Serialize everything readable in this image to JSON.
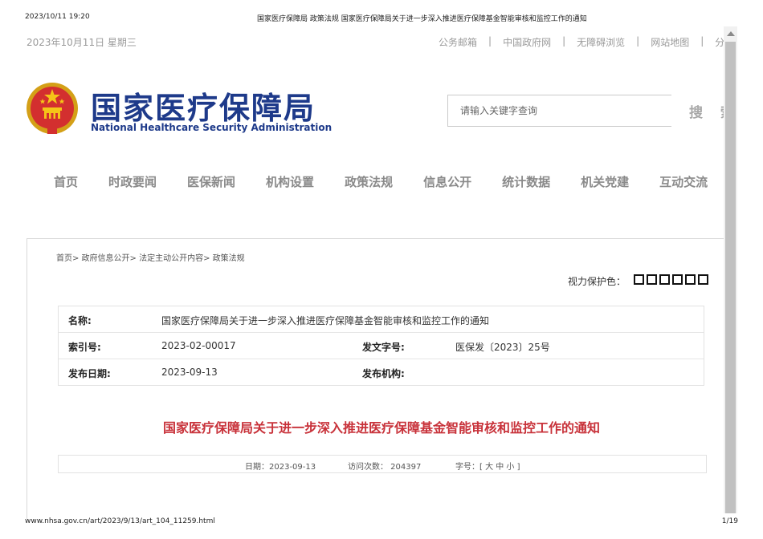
{
  "print": {
    "datetime": "2023/10/11 19:20",
    "title": "国家医疗保障局 政策法规 国家医疗保障局关于进一步深入推进医疗保障基金智能审核和监控工作的通知",
    "url": "www.nhsa.gov.cn/art/2023/9/13/art_104_11259.html",
    "page": "1/19"
  },
  "topbar": {
    "date": "2023年10月11日 星期三",
    "links": [
      "公务邮箱",
      "中国政府网",
      "无障碍浏览",
      "网站地图",
      "分"
    ]
  },
  "logo": {
    "cn": "国家医疗保障局",
    "en": "National Healthcare Security Administration"
  },
  "search": {
    "placeholder": "请输入关键字查询",
    "button": "搜 索"
  },
  "nav": [
    "首页",
    "时政要闻",
    "医保新闻",
    "机构设置",
    "政策法规",
    "信息公开",
    "统计数据",
    "机关党建",
    "互动交流"
  ],
  "breadcrumb": "首页> 政府信息公开> 法定主动公开内容> 政策法规",
  "eye_protect": {
    "label": "视力保护色：",
    "colors": [
      "#ffffff",
      "#ffffff",
      "#ffffff",
      "#ffffff",
      "#ffffff",
      "#ffffff"
    ]
  },
  "info": {
    "name_label": "名称:",
    "name": "国家医疗保障局关于进一步深入推进医疗保障基金智能审核和监控工作的通知",
    "index_label": "索引号:",
    "index": "2023-02-00017",
    "doc_no_label": "发文字号:",
    "doc_no": "医保发〔2023〕25号",
    "date_label": "发布日期:",
    "date": "2023-09-13",
    "org_label": "发布机构:",
    "org": ""
  },
  "doc_title": "国家医疗保障局关于进一步深入推进医疗保障基金智能审核和监控工作的通知",
  "meta": {
    "date": "日期：2023-09-13",
    "visits": "访问次数：  204397",
    "font_size": "字号：[ 大 中 小 ]"
  },
  "colors": {
    "logo_blue": "#1e3a8a",
    "title_red": "#c8323a"
  }
}
